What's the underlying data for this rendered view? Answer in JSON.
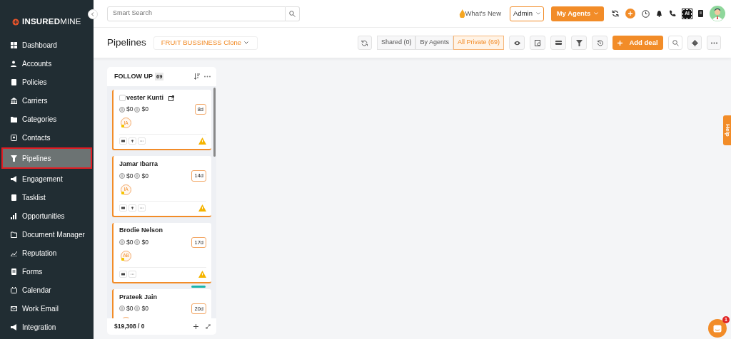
{
  "sidebar": {
    "logo": {
      "brand_bold": "INSURED",
      "brand_light": "MINE"
    },
    "items": [
      {
        "label": "Dashboard",
        "selected": false
      },
      {
        "label": "Accounts",
        "selected": false
      },
      {
        "label": "Policies",
        "selected": false
      },
      {
        "label": "Carriers",
        "selected": false
      },
      {
        "label": "Categories",
        "selected": false
      },
      {
        "label": "Contacts",
        "selected": false
      },
      {
        "label": "Pipelines",
        "selected": true
      },
      {
        "label": "Engagement",
        "selected": false
      },
      {
        "label": "Tasklist",
        "selected": false
      },
      {
        "label": "Opportunities",
        "selected": false
      },
      {
        "label": "Document Manager",
        "selected": false
      },
      {
        "label": "Reputation",
        "selected": false
      },
      {
        "label": "Forms",
        "selected": false
      },
      {
        "label": "Calendar",
        "selected": false
      },
      {
        "label": "Work Email",
        "selected": false
      },
      {
        "label": "Integration",
        "selected": false
      }
    ]
  },
  "topbar": {
    "search": {
      "placeholder": "Smart Search"
    },
    "whats_new": "What's New",
    "role": "Admin",
    "agents_button": "My Agents",
    "chip_label": "AI"
  },
  "toolbar": {
    "title": "Pipelines",
    "pipeline": "FRUIT BUSSINESS Clone",
    "filters": [
      {
        "label": "Shared (0)",
        "selected": false
      },
      {
        "label": "By Agents",
        "selected": false
      },
      {
        "label": "All Private (69)",
        "selected": true
      }
    ],
    "add_button": "Add deal"
  },
  "column": {
    "title": "FOLLOW UP",
    "count": "69",
    "total": "$19,308 / 0",
    "cards": [
      {
        "name": "vester Kunti",
        "checked": false,
        "link": true,
        "amount_1": "$0",
        "amount_2": "$0",
        "age": "8d",
        "initials": "IA",
        "actions": [
          {
            "kind": "email"
          },
          {
            "kind": "pin"
          },
          {
            "kind": "more"
          }
        ],
        "warning": true
      },
      {
        "name": "Jamar Ibarra",
        "amount_1": "$0",
        "amount_2": "$0",
        "age": "14d",
        "initials": "IA",
        "actions": [
          {
            "kind": "email"
          },
          {
            "kind": "pin"
          },
          {
            "kind": "more"
          }
        ],
        "warning": true
      },
      {
        "name": "Brodie Nelson",
        "amount_1": "$0",
        "amount_2": "$0",
        "age": "17d",
        "initials": "AB",
        "actions": [
          {
            "kind": "email"
          },
          {
            "kind": "more"
          }
        ],
        "warning": true
      },
      {
        "name": "Prateek Jain",
        "amount_1": "$0",
        "amount_2": "$0",
        "age": "20d",
        "color": "#1bb5ab"
      }
    ]
  },
  "help_tab": "Help",
  "chat": {
    "unread": "1"
  }
}
